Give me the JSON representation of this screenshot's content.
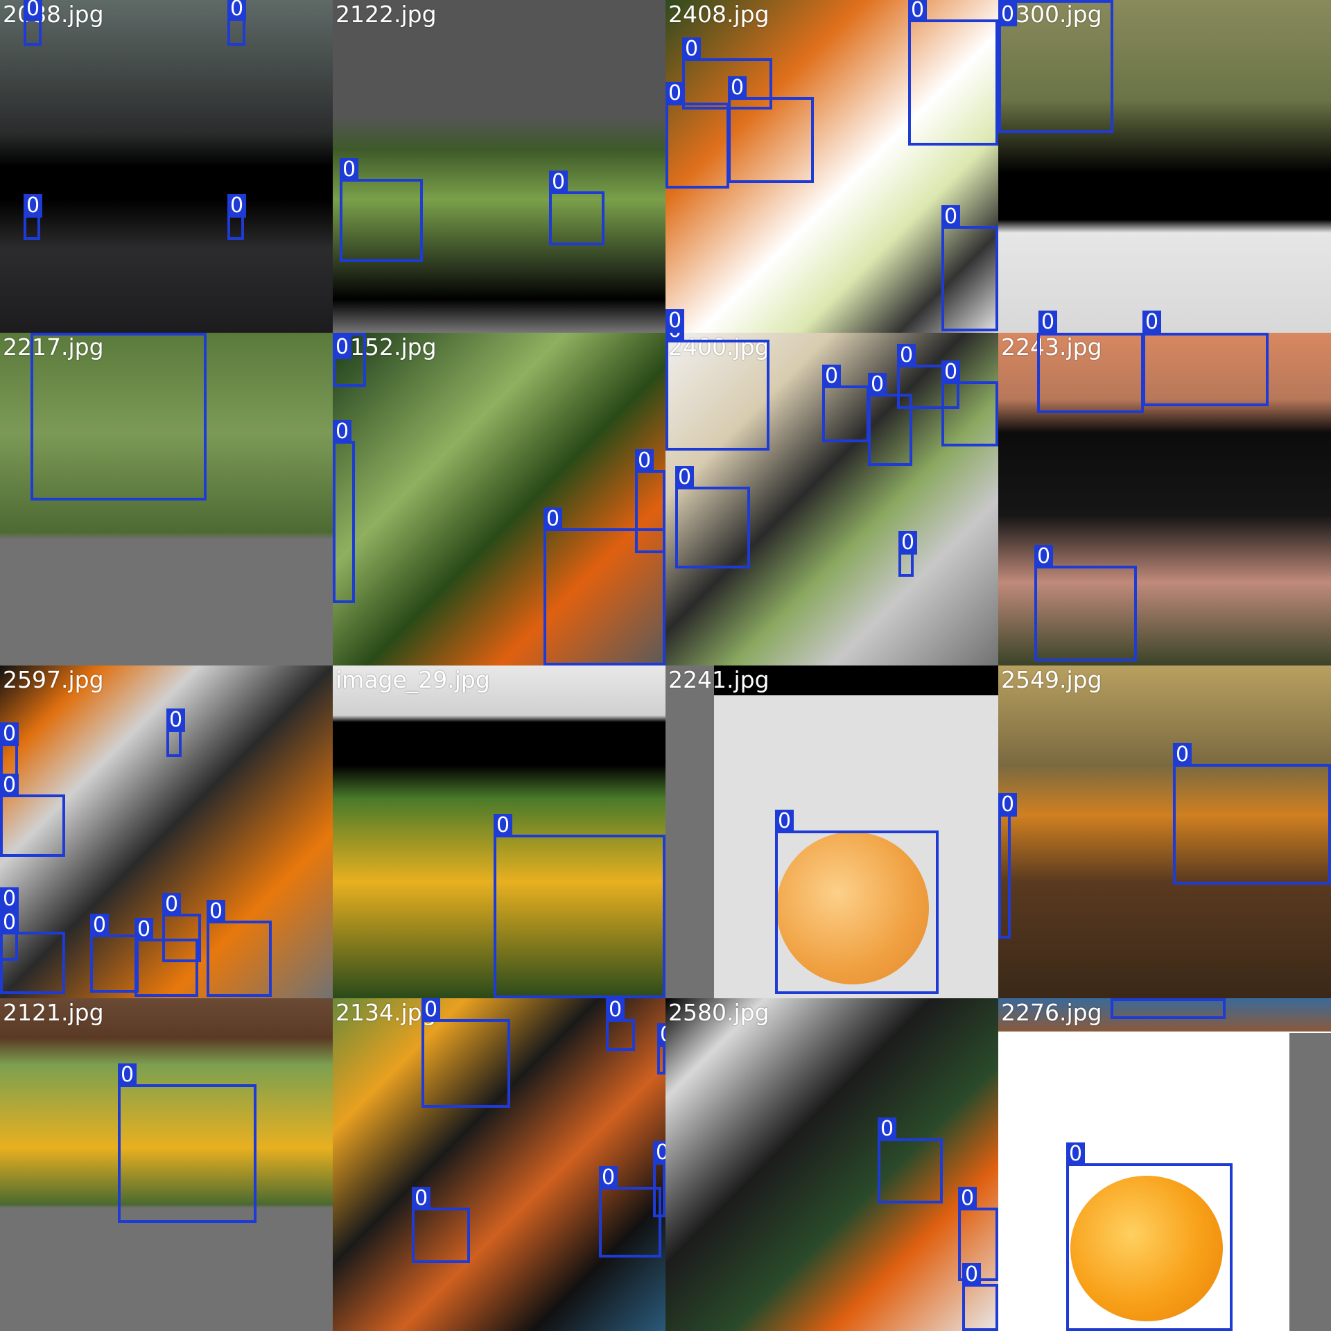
{
  "mosaic": {
    "box_label": "0",
    "box_color": "#1f3bd6",
    "tiles": [
      {
        "title": "2088.jpg"
      },
      {
        "title": "2122.jpg"
      },
      {
        "title": "2408.jpg"
      },
      {
        "title": "2300.jpg"
      },
      {
        "title": "2217.jpg"
      },
      {
        "title": "2152.jpg"
      },
      {
        "title": "2400.jpg"
      },
      {
        "title": "2243.jpg"
      },
      {
        "title": "2597.jpg"
      },
      {
        "title": "image_29.jpg"
      },
      {
        "title": "2241.jpg"
      },
      {
        "title": "2549.jpg"
      },
      {
        "title": "2121.jpg"
      },
      {
        "title": "2134.jpg"
      },
      {
        "title": "2580.jpg"
      },
      {
        "title": "2276.jpg"
      }
    ]
  }
}
